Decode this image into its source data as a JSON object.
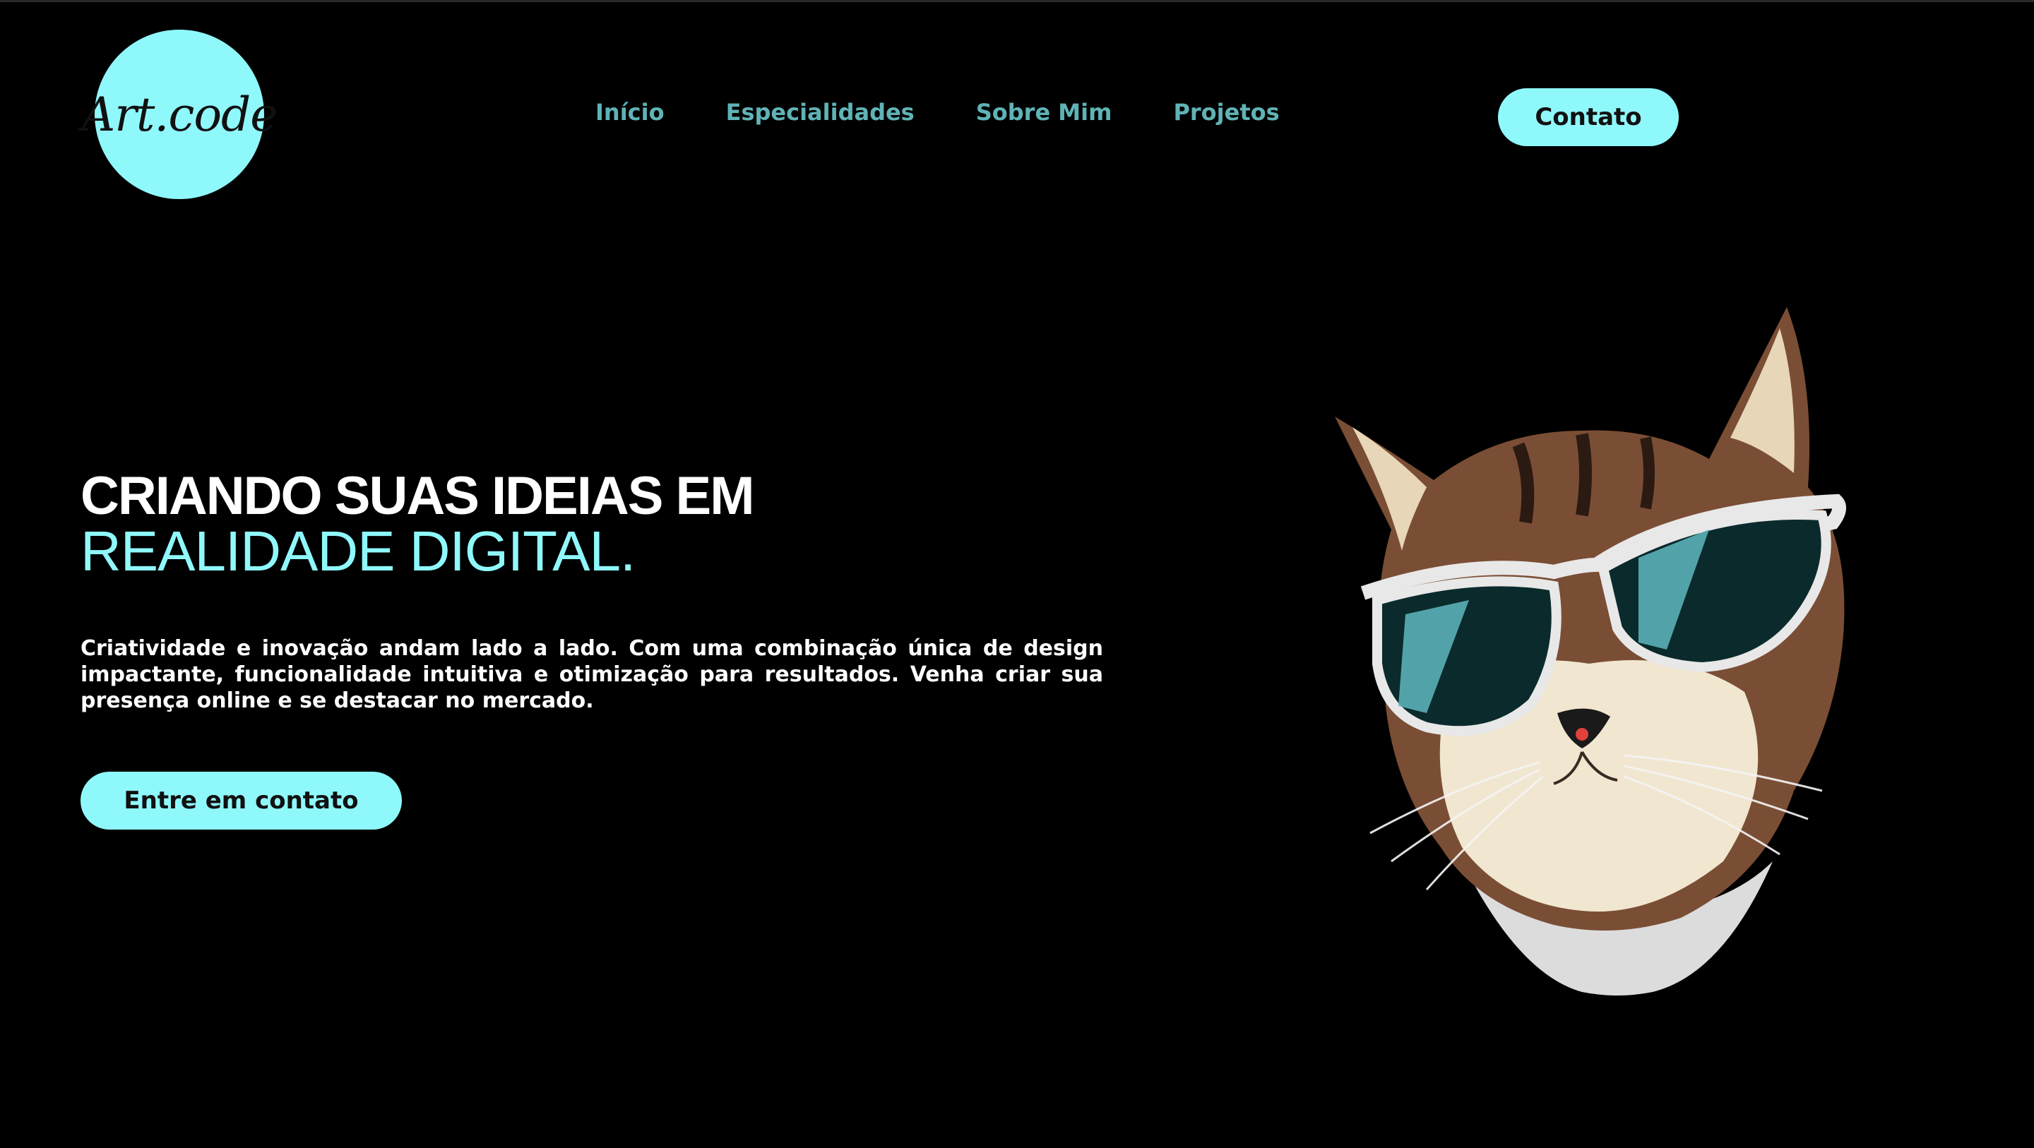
{
  "brand": {
    "logo_text": "Art.code",
    "accent_color": "#8ff8fb",
    "nav_color": "#5fb3b6",
    "background_color": "#000000"
  },
  "nav": {
    "items": [
      {
        "label": "Início"
      },
      {
        "label": "Especialidades"
      },
      {
        "label": "Sobre Mim"
      },
      {
        "label": "Projetos"
      }
    ],
    "contact_label": "Contato"
  },
  "hero": {
    "title_line1": "CRIANDO SUAS IDEIAS EM",
    "title_line2": "REALIDADE DIGITAL.",
    "description": "Criatividade e inovação andam lado a lado. Com uma combinação única de design impactante, funcionalidade intuitiva e otimização para resultados. Venha criar sua presença online e se destacar no mercado.",
    "cta_label": "Entre em contato"
  },
  "illustration": {
    "icon": "cat-with-sunglasses-illustration"
  }
}
